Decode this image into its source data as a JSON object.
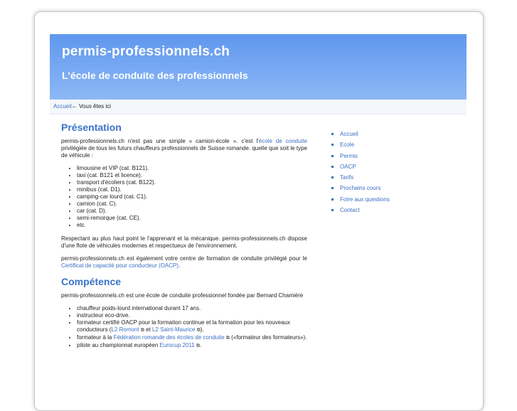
{
  "header": {
    "title": "permis-professionnels.ch",
    "tagline": "L'école de conduite des professionnels"
  },
  "breadcrumb": {
    "home": "Accueil",
    "suffix": "← Vous êtes ici"
  },
  "presentation": {
    "heading": "Présentation",
    "intro_pre": "permis-professionnels.ch n'est pas une simple « camion-école ». c'est l'",
    "intro_link": "école de conduite",
    "intro_post": " privilégiée de tous les futurs chauffeurs professionnels de Suisse romande. quelle que soit le type de véhicule :",
    "vehicles": [
      "limousine et VIP (cat. B121).",
      "taxi (cat. B121 et licence).",
      "transport d'écoliers (cat. B122).",
      "minibus (cat. D1).",
      "camping-car lourd (cat. C1).",
      "camion (cat. C).",
      "car (cat. D).",
      "semi-remorque (cat. CE).",
      "etc."
    ],
    "para2": "Respectant au plus haut point le l'apprenant et la mécanique. permis-professionnels.ch dispose d'une flote de véhicules modernes et respectueux de l'environnement.",
    "para3_pre": "permis-professionnels.ch est également votre centre de formation de conduite privilégié pour le ",
    "para3_link": "Certificat de capacité pour conducteur (OACP)",
    "para3_post": "."
  },
  "competence": {
    "heading": "Compétence",
    "intro": "permis-professionnels.ch est une école de conduite professionnel fondée par Bernard Chamière",
    "item1": "chauffeur poids-lourd international durant 17 ans.",
    "item2": "instructeur eco-drive.",
    "item3_pre": "formateur certifié OACP pour la formation continue et la formation pour les nouveaux conducteurs (",
    "item3_link1": "L2 Romont",
    "item3_mid": " et ",
    "item3_link2": "L2 Saint-Maurice",
    "item3_post": ").",
    "item4_pre": "formateur à la ",
    "item4_link": "Fédération romande des écoles de conduite",
    "item4_post": " («formateur des formateurs»).",
    "item5_pre": "pilote au championnat européen ",
    "item5_link": "Eurocup 2011",
    "item5_post": ".",
    "ext_glyph": "⧉"
  },
  "sidebar": {
    "items": [
      {
        "label": "Accueil"
      },
      {
        "label": "Ecole"
      },
      {
        "label": "Permis"
      },
      {
        "label": "OACP"
      },
      {
        "label": "Tarifs"
      },
      {
        "label": "Prochains cours"
      },
      {
        "label": "Foire aux questions"
      },
      {
        "label": "Contact"
      }
    ]
  },
  "colors": {
    "header_top": "#5f97ee",
    "header_bottom": "#8db8f5",
    "link": "#3a6fc4",
    "heading": "#3a73c8"
  }
}
